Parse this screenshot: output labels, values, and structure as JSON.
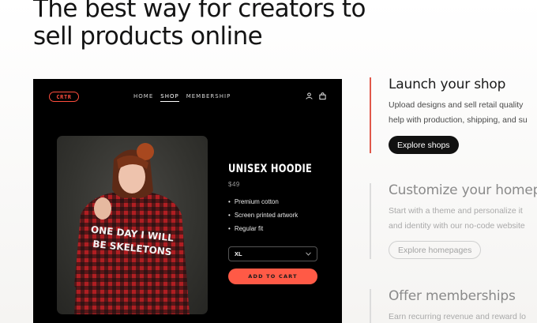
{
  "headline": "The best way for creators to\nsell products online",
  "store": {
    "logo": "CRTR",
    "nav": [
      "HOME",
      "SHOP",
      "MEMBERSHIP"
    ],
    "active_nav": "SHOP",
    "icons": [
      "user-icon",
      "bag-icon"
    ],
    "product": {
      "title": "UNISEX HOODIE",
      "price": "$49",
      "features": [
        "Premium cotton",
        "Screen printed artwork",
        "Regular fit"
      ],
      "size_value": "XL",
      "cart_label": "ADD TO CART",
      "hoodie_print": [
        "ONE DAY I WILL",
        "BE SKELETONS"
      ]
    },
    "accent_color": "#ff5a46"
  },
  "features": [
    {
      "title": "Launch your shop",
      "description": "Upload designs and sell retail quality\nhelp with production, shipping, and su",
      "button": "Explore shops",
      "active": true
    },
    {
      "title": "Customize your homep",
      "description": "Start with a theme and personalize it\nand identity with our no-code website",
      "button": "Explore homepages",
      "active": false
    },
    {
      "title": "Offer memberships",
      "description": "Earn recurring revenue and reward lo",
      "active": false
    }
  ]
}
